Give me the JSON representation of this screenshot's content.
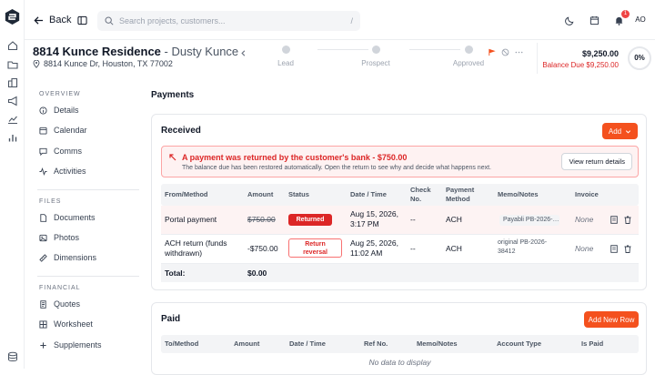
{
  "nav": {
    "back_label": "Back",
    "search_placeholder": "Search projects, customers...",
    "search_shortcut": "/",
    "notification_count": "1",
    "avatar_initials": "AO"
  },
  "project": {
    "title": "8814 Kunce Residence",
    "customer": " - Dusty Kunce",
    "address": "8814 Kunce Dr, Houston, TX 77002"
  },
  "stages": [
    {
      "label": "Lead"
    },
    {
      "label": "Prospect"
    },
    {
      "label": "Approved"
    }
  ],
  "summary": {
    "total": "$9,250.00",
    "balance_due": "Balance Due $9,250.00",
    "progress": "0%"
  },
  "sidebar": {
    "overview_title": "OVERVIEW",
    "overview_items": [
      {
        "label": "Details",
        "icon": "info-icon"
      },
      {
        "label": "Calendar",
        "icon": "calendar-icon"
      },
      {
        "label": "Comms",
        "icon": "chat-icon"
      },
      {
        "label": "Activities",
        "icon": "activity-icon"
      }
    ],
    "files_title": "FILES",
    "files_items": [
      {
        "label": "Documents",
        "icon": "document-icon"
      },
      {
        "label": "Photos",
        "icon": "image-icon"
      },
      {
        "label": "Dimensions",
        "icon": "ruler-icon"
      }
    ],
    "financial_title": "FINANCIAL",
    "financial_items": [
      {
        "label": "Quotes",
        "icon": "quote-icon"
      },
      {
        "label": "Worksheet",
        "icon": "grid-icon"
      },
      {
        "label": "Supplements",
        "icon": "plus-icon"
      }
    ]
  },
  "payments": {
    "title": "Payments",
    "received": {
      "title": "Received",
      "add_label": "Add",
      "alert_title": "A payment was returned by the customer's bank - $750.00",
      "alert_desc": "The balance due has been restored automatically. Open the return to see why and decide what happens next.",
      "alert_button": "View return details",
      "columns": {
        "from": "From/Method",
        "amount": "Amount",
        "status": "Status",
        "date": "Date / Time",
        "check1": "Check",
        "check2": "No.",
        "method1": "Payment",
        "method2": "Method",
        "memo": "Memo/Notes",
        "invoice": "Invoice"
      },
      "rows": [
        {
          "from": "Portal payment",
          "amount": "$750.00",
          "status": "Returned",
          "date1": "Aug 15, 2026,",
          "date2": "3:17 PM",
          "check": "--",
          "method": "ACH",
          "memo": "Payabli PB-2026-…",
          "invoice": "None"
        },
        {
          "from1": "ACH return (funds",
          "from2": "withdrawn)",
          "amount": "-$750.00",
          "status1": "Return",
          "status2": "reversal",
          "date1": "Aug 25, 2026,",
          "date2": "11:02 AM",
          "check": "--",
          "method": "ACH",
          "memo1": "original PB-2026-",
          "memo2": "38412",
          "invoice": "None"
        }
      ],
      "total_label": "Total:",
      "total_value": "$0.00"
    },
    "paid": {
      "title": "Paid",
      "add_label": "Add New Row",
      "columns": {
        "to": "To/Method",
        "amount": "Amount",
        "date": "Date / Time",
        "ref": "Ref No.",
        "memo": "Memo/Notes",
        "account": "Account Type",
        "ispaid": "Is Paid"
      },
      "empty": "No data to display"
    }
  },
  "colors": {
    "accent": "#f4511e",
    "danger": "#dc2626"
  }
}
